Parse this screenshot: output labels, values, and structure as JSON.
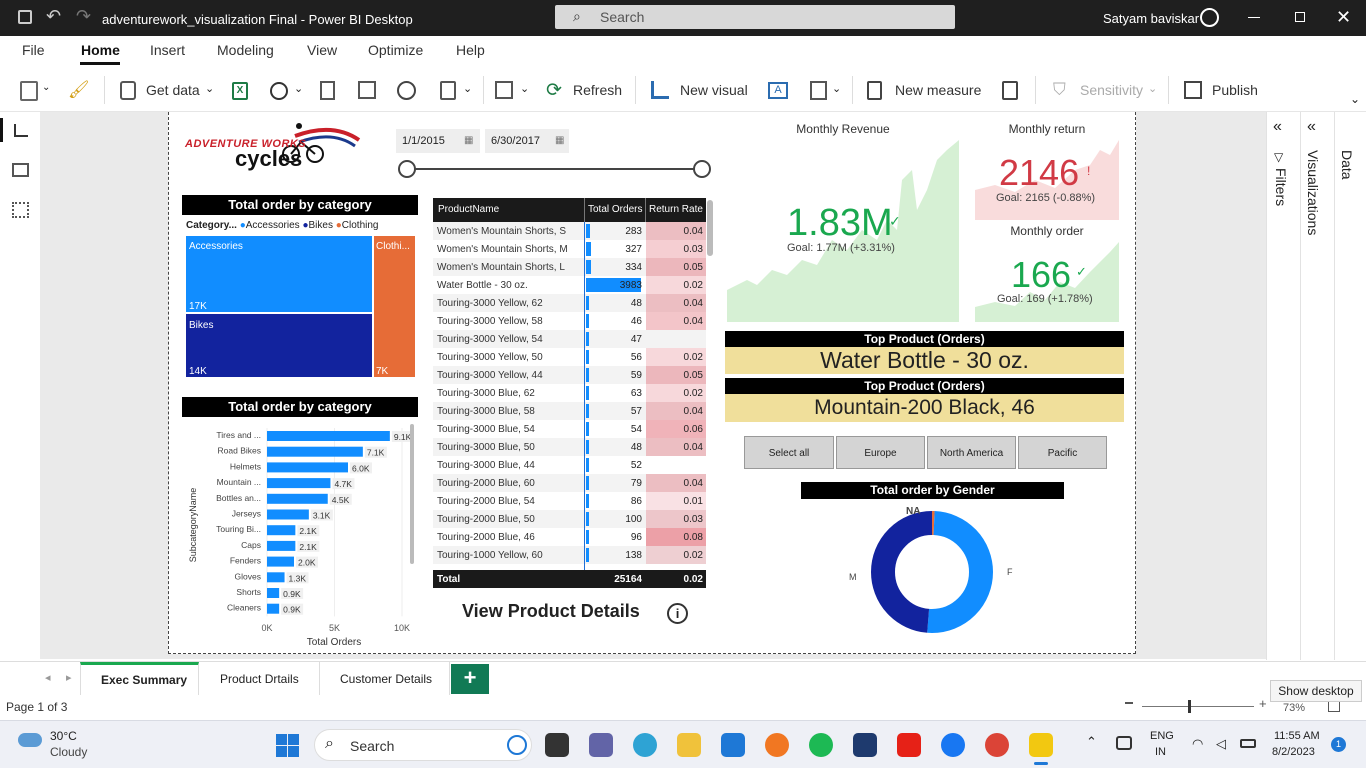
{
  "window": {
    "title": "adventurework_visualization Final - Power BI Desktop",
    "search_placeholder": "Search",
    "user": "Satyam baviskar"
  },
  "menu": [
    "File",
    "Home",
    "Insert",
    "Modeling",
    "View",
    "Optimize",
    "Help"
  ],
  "ribbon": {
    "get_data": "Get data",
    "refresh": "Refresh",
    "new_visual": "New visual",
    "new_measure": "New measure",
    "sensitivity": "Sensitivity",
    "publish": "Publish"
  },
  "report": {
    "logo_line1": "ADVENTURE WORKS",
    "logo_line2": "cycles",
    "date_from": "1/1/2015",
    "date_to": "6/30/2017",
    "treemap": {
      "title": "Total order by category",
      "legend_label": "Category...",
      "legend": [
        {
          "name": "Accessories",
          "color": "#118DFF"
        },
        {
          "name": "Bikes",
          "color": "#12239E"
        },
        {
          "name": "Clothing",
          "color": "#E66C37"
        }
      ],
      "tiles": {
        "accessories": {
          "label": "Accessories",
          "value": "17K"
        },
        "bikes": {
          "label": "Bikes",
          "value": "14K"
        },
        "clothing": {
          "label": "Clothi...",
          "value": "7K"
        }
      }
    },
    "table": {
      "headers": [
        "ProductName",
        "Total Orders",
        "Return Rate"
      ],
      "rows": [
        {
          "name": "Women's Mountain Shorts, S",
          "orders": "283",
          "rate": "0.04"
        },
        {
          "name": "Women's Mountain Shorts, M",
          "orders": "327",
          "rate": "0.03"
        },
        {
          "name": "Women's Mountain Shorts, L",
          "orders": "334",
          "rate": "0.05"
        },
        {
          "name": "Water Bottle - 30 oz.",
          "orders": "3983",
          "rate": "0.02"
        },
        {
          "name": "Touring-3000 Yellow, 62",
          "orders": "48",
          "rate": "0.04"
        },
        {
          "name": "Touring-3000 Yellow, 58",
          "orders": "46",
          "rate": "0.04"
        },
        {
          "name": "Touring-3000 Yellow, 54",
          "orders": "47",
          "rate": ""
        },
        {
          "name": "Touring-3000 Yellow, 50",
          "orders": "56",
          "rate": "0.02"
        },
        {
          "name": "Touring-3000 Yellow, 44",
          "orders": "59",
          "rate": "0.05"
        },
        {
          "name": "Touring-3000 Blue, 62",
          "orders": "63",
          "rate": "0.02"
        },
        {
          "name": "Touring-3000 Blue, 58",
          "orders": "57",
          "rate": "0.04"
        },
        {
          "name": "Touring-3000 Blue, 54",
          "orders": "54",
          "rate": "0.06"
        },
        {
          "name": "Touring-3000 Blue, 50",
          "orders": "48",
          "rate": "0.04"
        },
        {
          "name": "Touring-3000 Blue, 44",
          "orders": "52",
          "rate": ""
        },
        {
          "name": "Touring-2000 Blue, 60",
          "orders": "79",
          "rate": "0.04"
        },
        {
          "name": "Touring-2000 Blue, 54",
          "orders": "86",
          "rate": "0.01"
        },
        {
          "name": "Touring-2000 Blue, 50",
          "orders": "100",
          "rate": "0.03"
        },
        {
          "name": "Touring-2000 Blue, 46",
          "orders": "96",
          "rate": "0.08"
        },
        {
          "name": "Touring-1000 Yellow, 60",
          "orders": "138",
          "rate": "0.02"
        }
      ],
      "total_label": "Total",
      "total_orders": "25164",
      "total_rate": "0.02"
    },
    "view_details": "View Product Details",
    "kpis": {
      "revenue": {
        "title": "Monthly Revenue",
        "value": "1.83M",
        "goal": "Goal: 1.77M (+3.31%)"
      },
      "returns": {
        "title": "Monthly return",
        "value": "2146",
        "goal": "Goal: 2165 (-0.88%)"
      },
      "orders": {
        "title": "Monthly order",
        "value": "166",
        "goal": "Goal: 169 (+1.78%)"
      }
    },
    "top1": {
      "title": "Top Product (Orders)",
      "value": "Water Bottle - 30 oz."
    },
    "top2": {
      "title": "Top Product (Orders)",
      "value": "Mountain-200 Black, 46"
    },
    "slicers": [
      "Select all",
      "Europe",
      "North America",
      "Pacific"
    ],
    "donut_title": "Total order by Gender",
    "donut_labels": {
      "na": "NA",
      "m": "M",
      "f": "F"
    }
  },
  "chart_data": [
    {
      "type": "bar",
      "title": "Total order by category",
      "xlabel": "Total Orders",
      "ylabel": "SubcategoryName",
      "xlim": [
        0,
        10000
      ],
      "x_ticks": [
        "0K",
        "5K",
        "10K"
      ],
      "categories": [
        "Tires and ...",
        "Road Bikes",
        "Helmets",
        "Mountain ...",
        "Bottles an...",
        "Jerseys",
        "Touring Bi...",
        "Caps",
        "Fenders",
        "Gloves",
        "Shorts",
        "Cleaners"
      ],
      "values": [
        9100,
        7100,
        6000,
        4700,
        4500,
        3100,
        2100,
        2100,
        2000,
        1300,
        900,
        900
      ],
      "value_labels": [
        "9.1K",
        "7.1K",
        "6.0K",
        "4.7K",
        "4.5K",
        "3.1K",
        "2.1K",
        "2.1K",
        "2.0K",
        "1.3K",
        "0.9K",
        "0.9K"
      ],
      "color": "#118DFF"
    },
    {
      "type": "pie",
      "title": "Total order by Gender",
      "categories": [
        "F",
        "M",
        "NA"
      ],
      "values": [
        50.5,
        48.8,
        0.7
      ],
      "colors": [
        "#118DFF",
        "#12239E",
        "#E66C37"
      ]
    }
  ],
  "tabs": [
    "Exec Summary",
    "Product Drtails",
    "Customer Details"
  ],
  "status": {
    "page": "Page 1 of 3",
    "zoom": "73%",
    "show_desktop": "Show desktop"
  },
  "right_panes": {
    "filters": "Filters",
    "visualizations": "Visualizations",
    "data": "Data"
  },
  "taskbar": {
    "temp": "30°C",
    "weather": "Cloudy",
    "search": "Search",
    "lang1": "ENG",
    "lang2": "IN",
    "time": "11:55 AM",
    "date": "8/2/2023",
    "notif": "1"
  }
}
